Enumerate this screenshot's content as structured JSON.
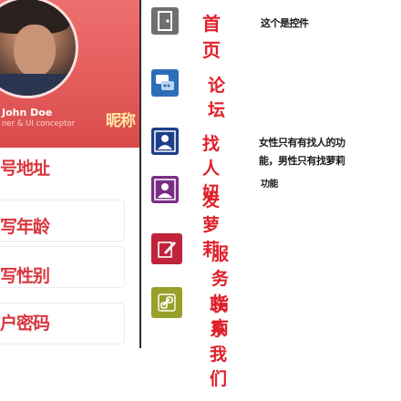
{
  "profile": {
    "name": "John Doe",
    "role": "ner & UI conceptor",
    "nickname_label": "昵称"
  },
  "form": {
    "address_label": "号地址",
    "age_label": "写年龄",
    "gender_label": "写性别",
    "password_label": "户密码"
  },
  "menu": {
    "home": {
      "label": "首页",
      "desc": "这个是控件"
    },
    "forum": {
      "label": "论坛"
    },
    "find": {
      "label": "找人妞",
      "desc_line1": "女性只有有找人的功",
      "desc_line2": "能，男性只有找萝莉"
    },
    "loli": {
      "label": "发萝莉",
      "superscript": "功能"
    },
    "guide": {
      "label": "服务指南"
    },
    "contact": {
      "label": "联系我们"
    }
  },
  "colors": {
    "accent_red": "#e0202a",
    "header_salmon": "#e35a5a",
    "tile_gray": "#6f6f6f",
    "tile_blue": "#2d6db7",
    "tile_darkblue": "#1e3f8a",
    "tile_purple": "#7a2e86",
    "tile_crimson": "#c0233b",
    "tile_olive": "#97a12a"
  }
}
